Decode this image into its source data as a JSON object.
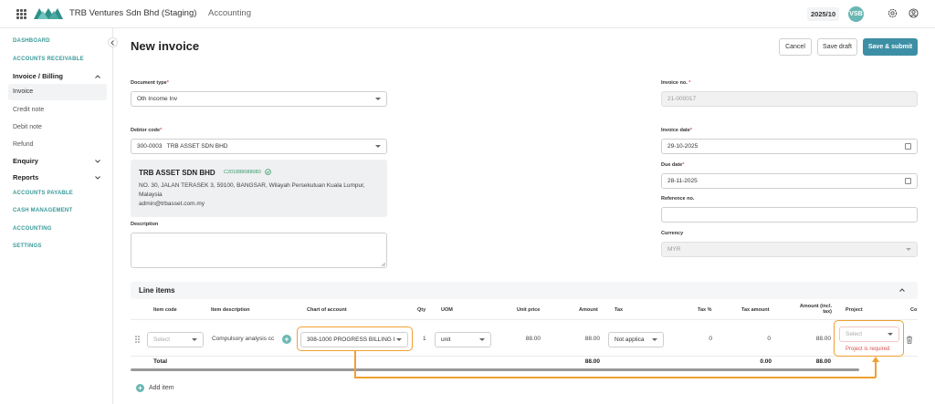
{
  "header": {
    "company": "TRB Ventures Sdn Bhd (Staging)",
    "module": "Accounting",
    "period": "2025/10",
    "avatar": "VSB"
  },
  "sidebar": {
    "dashboard": "DASHBOARD",
    "accounts_receivable": "ACCOUNTS RECEIVABLE",
    "invoice_billing": "Invoice / Billing",
    "invoice": "Invoice",
    "credit_note": "Credit note",
    "debit_note": "Debit note",
    "refund": "Refund",
    "enquiry": "Enquiry",
    "reports": "Reports",
    "accounts_payable": "ACCOUNTS PAYABLE",
    "cash_management": "CASH MANAGEMENT",
    "accounting": "ACCOUNTING",
    "settings": "SETTINGS"
  },
  "page": {
    "title": "New invoice",
    "cancel": "Cancel",
    "save_draft": "Save draft",
    "save_submit": "Save & submit"
  },
  "form": {
    "document_type_label": "Document type",
    "document_type_value": "Oth Income Inv",
    "debtor_code_label": "Debtor code",
    "debtor_code_value": "300-0003   TRB ASSET SDN BHD",
    "debtor_name": "TRB ASSET SDN BHD",
    "debtor_reg": "C201888088080",
    "debtor_address_1": "NO. 30, JALAN TERASEK 3, 59100, BANGSAR, Wilayah Persekutuan Kuala Lumpur,",
    "debtor_address_2": "Malaysia",
    "debtor_email": "admin@trbasset.com.my",
    "description_label": "Description",
    "invoice_no_label": "Invoice no.",
    "invoice_no_value": "21-000017",
    "invoice_date_label": "Invoice date",
    "invoice_date_value": "29-10-2025",
    "due_date_label": "Due date",
    "due_date_value": "28-11-2025",
    "reference_label": "Reference no.",
    "currency_label": "Currency",
    "currency_value": "MYR"
  },
  "line_items": {
    "section_title": "Line items",
    "headers": {
      "item_code": "Item code",
      "item_description": "Item description",
      "chart_of_account": "Chart of account",
      "qty": "Qty",
      "uom": "UOM",
      "unit_price": "Unit price",
      "amount": "Amount",
      "tax": "Tax",
      "tax_pct": "Tax %",
      "tax_amount": "Tax amount",
      "amount_incl_1": "Amount (incl.",
      "amount_incl_2": "tax)",
      "project": "Project",
      "cost_centre": "Co"
    },
    "rows": [
      {
        "item_code": "Select",
        "item_description": "Compulsory analysis cc",
        "chart_of_account": "308-1000 PROGRESS BILLING I",
        "qty": "1",
        "uom": "unit",
        "unit_price": "88.00",
        "amount": "88.00",
        "tax": "Not applica",
        "tax_pct": "0",
        "tax_amount": "0",
        "amount_incl": "88.00",
        "project": "Select",
        "project_error": "Project is required"
      }
    ],
    "total_label": "Total",
    "total_amount": "88.00",
    "total_tax": "0.00",
    "total_incl": "88.00",
    "add_item": "Add item"
  },
  "colors": {
    "accent": "#3d8fa5",
    "nav": "#3a9a9a",
    "highlight": "#f0a030",
    "error": "#d9534f"
  }
}
